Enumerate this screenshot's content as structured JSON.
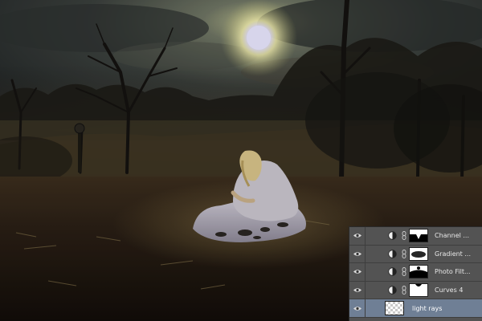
{
  "layers_panel": {
    "layers": [
      {
        "name": "Channel ...",
        "type": "adjustment",
        "visible": true
      },
      {
        "name": "Gradient ...",
        "type": "adjustment",
        "visible": true
      },
      {
        "name": "Photo Filt...",
        "type": "adjustment",
        "visible": true
      },
      {
        "name": "Curves 4",
        "type": "adjustment",
        "visible": true
      },
      {
        "name": "light rays",
        "type": "pixel",
        "visible": true,
        "selected": true
      }
    ]
  },
  "colors": {
    "panel_bg": "#535353",
    "selected_row": "#6f7f95",
    "sun_glow": "#f4f0b0"
  }
}
